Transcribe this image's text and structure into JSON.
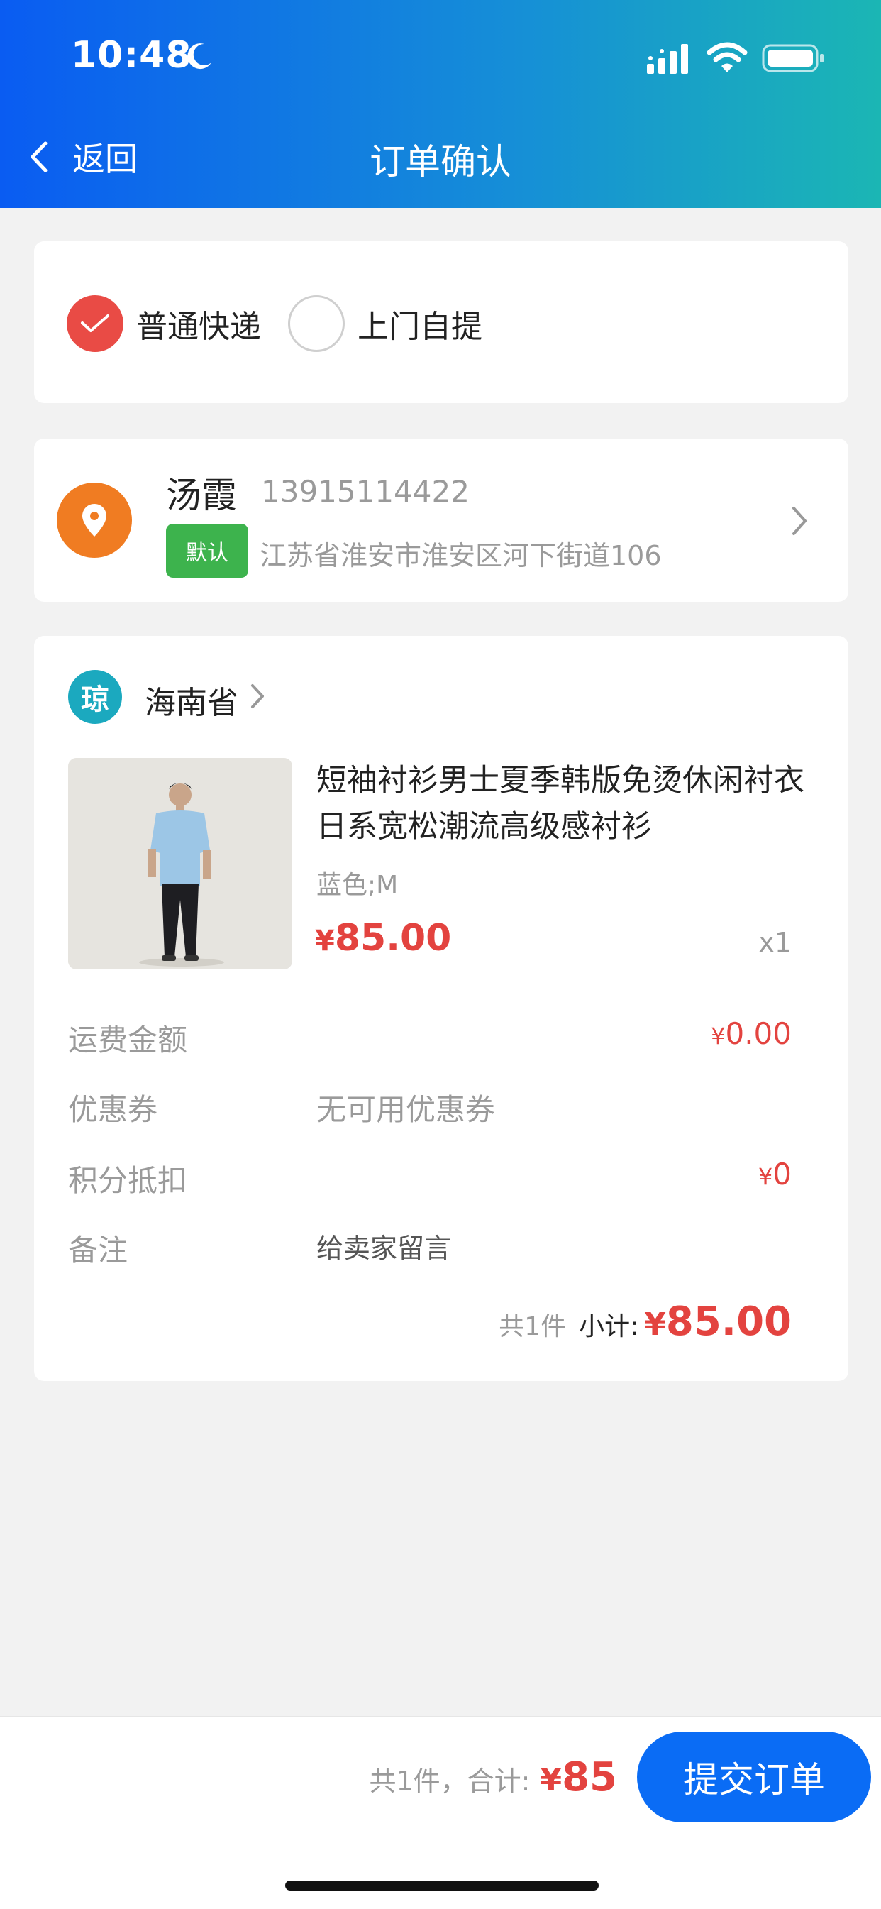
{
  "status_bar": {
    "time": "10:48"
  },
  "nav": {
    "back_label": "返回",
    "title": "订单确认"
  },
  "delivery": {
    "options": [
      {
        "label": "普通快递",
        "selected": true
      },
      {
        "label": "上门自提",
        "selected": false
      }
    ]
  },
  "address": {
    "name": "汤霞",
    "phone": "13915114422",
    "default_tag": "默认",
    "detail": "江苏省淮安市淮安区河下街道106"
  },
  "store": {
    "badge": "琼",
    "name": "海南省"
  },
  "product": {
    "title": "短袖衬衫男士夏季韩版免烫休闲衬衣日系宽松潮流高级感衬衫",
    "spec": "蓝色;M",
    "currency": "¥",
    "price": "85.00",
    "qty": "x1"
  },
  "fees": {
    "shipping_label": "运费金额",
    "shipping_currency": "¥",
    "shipping_value": "0.00",
    "coupon_label": "优惠券",
    "coupon_value": "无可用优惠券",
    "points_label": "积分抵扣",
    "points_currency": "¥",
    "points_value": "0",
    "remark_label": "备注",
    "remark_placeholder": "给卖家留言"
  },
  "subtotal": {
    "count": "共1件",
    "label": "小计:",
    "currency": "¥",
    "amount": "85.00"
  },
  "bottom": {
    "total_text": "共1件，合计:",
    "currency": "¥",
    "total": "85",
    "submit_label": "提交订单"
  },
  "colors": {
    "header_start": "#0a5cf2",
    "header_end": "#1bb6b4",
    "price_red": "#e3433f",
    "checked_red": "#e94b45",
    "location_orange": "#f07c22",
    "default_green": "#3db34d",
    "store_teal": "#1ba9bf",
    "submit_blue": "#0a6cf5"
  }
}
